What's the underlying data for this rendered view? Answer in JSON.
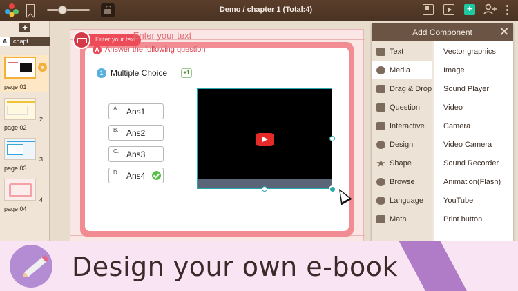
{
  "toolbar": {
    "doc_title": "Demo / chapter 1  (Total:4)",
    "zoom_level": 0.35
  },
  "pages_panel": {
    "add_label": "+",
    "chapter_tab_a": "A",
    "chapter_tab_name": "chapt..",
    "pages": [
      {
        "label": "page 01",
        "number": ""
      },
      {
        "label": "page 02",
        "number": "2"
      },
      {
        "label": "page 03",
        "number": "3"
      },
      {
        "label": "page 04",
        "number": "4"
      }
    ]
  },
  "canvas": {
    "tag_text": "Enter your text",
    "title": "Enter your text",
    "question_badge": "A",
    "question_text": "Answer the following question",
    "mc_number": "1",
    "mc_title": "Multiple Choice",
    "points_badge": "+1",
    "answers": [
      {
        "letter": "A.",
        "text": "Ans1",
        "correct": false
      },
      {
        "letter": "B.",
        "text": "Ans2",
        "correct": false
      },
      {
        "letter": "C.",
        "text": "Ans3",
        "correct": false
      },
      {
        "letter": "D.",
        "text": "Ans4",
        "correct": true
      }
    ]
  },
  "component_panel": {
    "title": "Add Component",
    "categories": [
      {
        "label": "Text",
        "icon": "text-icon"
      },
      {
        "label": "Media",
        "icon": "media-icon"
      },
      {
        "label": "Drag & Drop",
        "icon": "drag-drop-icon"
      },
      {
        "label": "Question",
        "icon": "question-icon"
      },
      {
        "label": "Interactive",
        "icon": "hand-icon"
      },
      {
        "label": "Design",
        "icon": "palette-icon"
      },
      {
        "label": "Shape",
        "icon": "star-icon"
      },
      {
        "label": "Browse",
        "icon": "globe-icon"
      },
      {
        "label": "Language",
        "icon": "lips-icon"
      },
      {
        "label": "Math",
        "icon": "pencil-ruler-icon"
      }
    ],
    "active_category": "Media",
    "items": [
      "Vector graphics",
      "Image",
      "Sound Player",
      "Video",
      "Camera",
      "Video Camera",
      "Sound Recorder",
      "Animation(Flash)",
      "YouTube",
      "Print button"
    ]
  },
  "banner": {
    "text": "Design your own e-book"
  },
  "colors": {
    "accent_red": "#ec4b57",
    "teal": "#28a9b1",
    "banner_purple": "#b07cc7",
    "toolbar_brown": "#4a3323"
  }
}
